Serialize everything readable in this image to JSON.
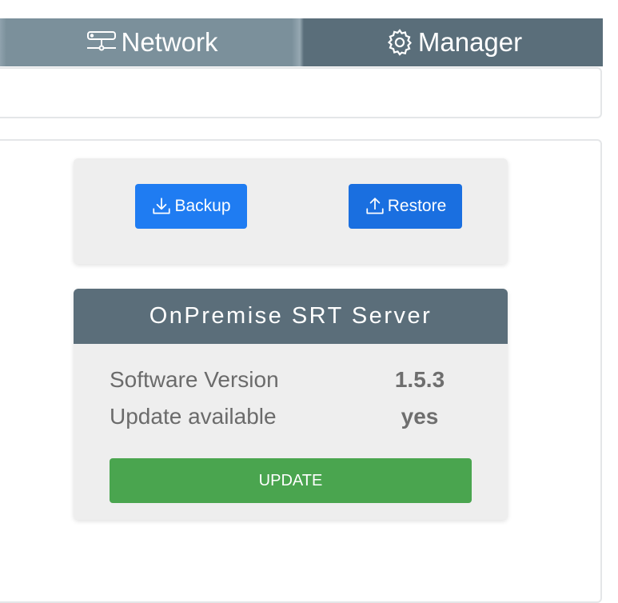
{
  "nav": {
    "tabs": [
      {
        "label": "Network",
        "icon": "network-icon",
        "active": true
      },
      {
        "label": "Manager",
        "icon": "gear-icon",
        "active": false
      }
    ]
  },
  "backup_card": {
    "backup_label": "Backup",
    "restore_label": "Restore"
  },
  "server_card": {
    "title": "OnPremise SRT Server",
    "rows": [
      {
        "label": "Software Version",
        "value": "1.5.3"
      },
      {
        "label": "Update available",
        "value": "yes"
      }
    ],
    "update_label": "UPDATE"
  },
  "colors": {
    "header_bg": "#5a6e7a",
    "active_tab_bg": "#7b909b",
    "primary_button": "#1f7cf2",
    "update_button": "#4aa54f",
    "card_bg": "#eeeeee"
  }
}
